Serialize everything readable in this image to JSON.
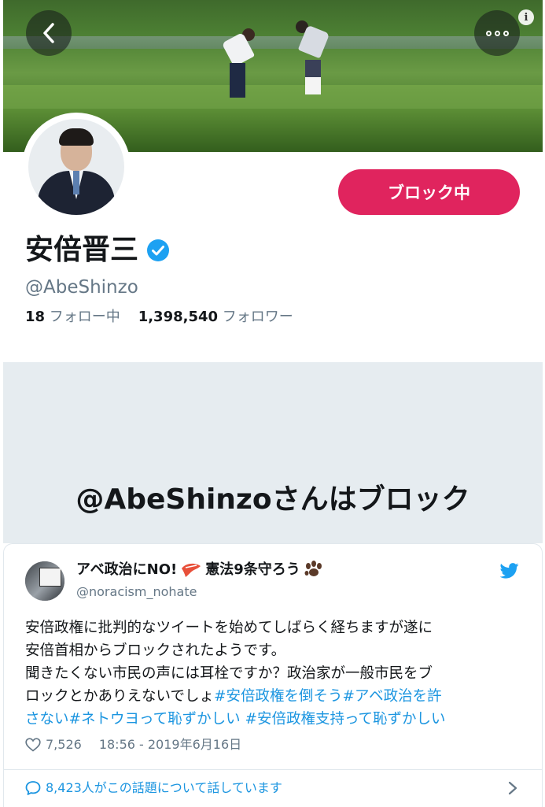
{
  "profile": {
    "name": "安倍晋三",
    "handle": "@AbeShinzo",
    "following_count": "18",
    "following_label": "フォロー中",
    "followers_count": "1,398,540",
    "followers_label": "フォロワー",
    "block_button_label": "ブロック中",
    "blocked_notice": "@AbeShinzoさんはブロック"
  },
  "tweet": {
    "author_name": "アベ政治にNO!",
    "author_name_mid": "憲法9条守ろう",
    "author_handle": "@noracism_nohate",
    "text_line1": "安倍政権に批判的なツイートを始めてしばらく経ちますが遂に",
    "text_line2": "安倍首相からブロックされたようです。",
    "text_line3": "聞きたくない市民の声には耳栓ですか？政治家が一般市民をブ",
    "text_line4_plain": "ロックとかありえないでしょ",
    "hashtag1": "#安倍政権を倒そう",
    "hashtag2": "#アベ政治を許",
    "hashtag2_cont": "さない",
    "hashtag3": "#ネトウヨって恥ずかしい",
    "hashtag4": "#安倍政権支持って恥ずかしい",
    "likes": "7,526",
    "timestamp": "18:56 - 2019年6月16日",
    "conversation": "8,423人がこの話題について話しています"
  },
  "colors": {
    "block_red": "#e0245e",
    "link_blue": "#1b95e0",
    "verified_blue": "#1da1f2",
    "muted_gray": "#657786",
    "blocked_bg": "#e6ecf0"
  },
  "icons": {
    "back": "chevron-left-icon",
    "more": "more-dots-icon",
    "info": "info-icon",
    "verified": "verified-badge-icon",
    "bird": "twitter-bird-icon",
    "heart": "heart-icon",
    "chat": "chat-bubble-icon",
    "chevron": "chevron-right-icon"
  }
}
